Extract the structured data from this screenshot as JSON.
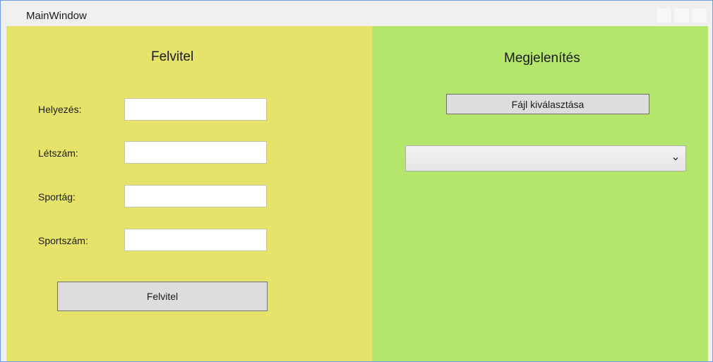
{
  "window": {
    "title": "MainWindow"
  },
  "left_panel": {
    "heading": "Felvitel",
    "fields": [
      {
        "label": "Helyezés:",
        "value": ""
      },
      {
        "label": "Létszám:",
        "value": ""
      },
      {
        "label": "Sportág:",
        "value": ""
      },
      {
        "label": "Sportszám:",
        "value": ""
      }
    ],
    "submit_label": "Felvitel",
    "background": "#e6e36a"
  },
  "right_panel": {
    "heading": "Megjelenítés",
    "file_button_label": "Fájl kiválasztása",
    "combo_value": "",
    "background": "#b3e66b"
  }
}
